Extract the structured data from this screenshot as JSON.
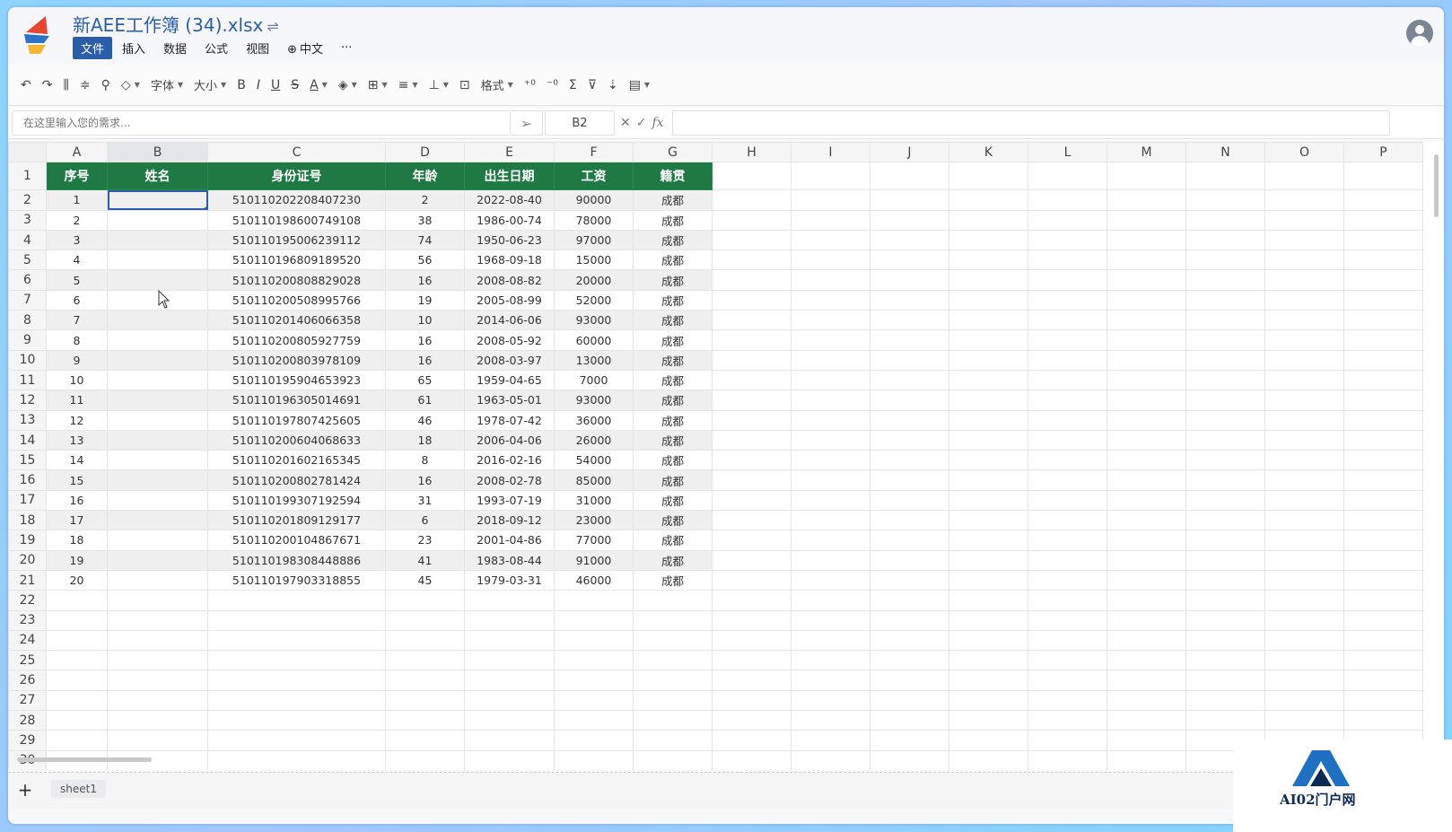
{
  "app": {
    "doc_title": "新AEE工作簿 (34).xlsx",
    "swap_glyph": "⇌",
    "menu": [
      {
        "label": "文件",
        "active": true
      },
      {
        "label": "插入"
      },
      {
        "label": "数据"
      },
      {
        "label": "公式"
      },
      {
        "label": "视图"
      },
      {
        "label": "中文"
      },
      {
        "label": "···"
      }
    ]
  },
  "toolbar": {
    "undo": "↶",
    "redo": "↷",
    "font_label": "字体",
    "size_label": "大小",
    "bold": "B",
    "italic": "I",
    "underline": "U",
    "strike": "S",
    "font_color": "A",
    "format_label": "格式",
    "sum": "Σ"
  },
  "formula_bar": {
    "prompt_placeholder": "在这里输入您的需求...",
    "cell_ref": "B2",
    "cancel": "✕",
    "confirm": "✓",
    "fx": "fx"
  },
  "sheet": {
    "columns": [
      "A",
      "B",
      "C",
      "D",
      "E",
      "F",
      "G",
      "H",
      "I",
      "J",
      "K",
      "L",
      "M",
      "N",
      "O",
      "P"
    ],
    "selected_column": "B",
    "selected_cell": "B2",
    "header_row": [
      "序号",
      "姓名",
      "身份证号",
      "年龄",
      "出生日期",
      "工资",
      "籍贯"
    ],
    "rows": [
      [
        "1",
        "",
        "510110202208407230",
        "2",
        "2022-08-40",
        "90000",
        "成都"
      ],
      [
        "2",
        "",
        "510110198600749108",
        "38",
        "1986-00-74",
        "78000",
        "成都"
      ],
      [
        "3",
        "",
        "510110195006239112",
        "74",
        "1950-06-23",
        "97000",
        "成都"
      ],
      [
        "4",
        "",
        "510110196809189520",
        "56",
        "1968-09-18",
        "15000",
        "成都"
      ],
      [
        "5",
        "",
        "510110200808829028",
        "16",
        "2008-08-82",
        "20000",
        "成都"
      ],
      [
        "6",
        "",
        "510110200508995766",
        "19",
        "2005-08-99",
        "52000",
        "成都"
      ],
      [
        "7",
        "",
        "510110201406066358",
        "10",
        "2014-06-06",
        "93000",
        "成都"
      ],
      [
        "8",
        "",
        "510110200805927759",
        "16",
        "2008-05-92",
        "60000",
        "成都"
      ],
      [
        "9",
        "",
        "510110200803978109",
        "16",
        "2008-03-97",
        "13000",
        "成都"
      ],
      [
        "10",
        "",
        "510110195904653923",
        "65",
        "1959-04-65",
        "7000",
        "成都"
      ],
      [
        "11",
        "",
        "510110196305014691",
        "61",
        "1963-05-01",
        "93000",
        "成都"
      ],
      [
        "12",
        "",
        "510110197807425605",
        "46",
        "1978-07-42",
        "36000",
        "成都"
      ],
      [
        "13",
        "",
        "510110200604068633",
        "18",
        "2006-04-06",
        "26000",
        "成都"
      ],
      [
        "14",
        "",
        "510110201602165345",
        "8",
        "2016-02-16",
        "54000",
        "成都"
      ],
      [
        "15",
        "",
        "510110200802781424",
        "16",
        "2008-02-78",
        "85000",
        "成都"
      ],
      [
        "16",
        "",
        "510110199307192594",
        "31",
        "1993-07-19",
        "31000",
        "成都"
      ],
      [
        "17",
        "",
        "510110201809129177",
        "6",
        "2018-09-12",
        "23000",
        "成都"
      ],
      [
        "18",
        "",
        "510110200104867671",
        "23",
        "2001-04-86",
        "77000",
        "成都"
      ],
      [
        "19",
        "",
        "510110198308448886",
        "41",
        "1983-08-44",
        "91000",
        "成都"
      ],
      [
        "20",
        "",
        "510110197903318855",
        "45",
        "1979-03-31",
        "46000",
        "成都"
      ]
    ],
    "row_numbers": [
      "1",
      "2",
      "3",
      "4",
      "5",
      "6",
      "7",
      "8",
      "9",
      "10",
      "11",
      "12",
      "13",
      "14",
      "15",
      "16",
      "17",
      "18",
      "19",
      "20",
      "21",
      "22",
      "23",
      "24",
      "25",
      "26",
      "27",
      "28",
      "29",
      "30"
    ],
    "tab_name": "sheet1",
    "add_sheet": "+"
  },
  "colors": {
    "header_green": "#1e7a42",
    "accent_blue": "#2b5ea8",
    "stripe_gray": "#efefef"
  },
  "watermark": {
    "text": "AI02门户网"
  }
}
